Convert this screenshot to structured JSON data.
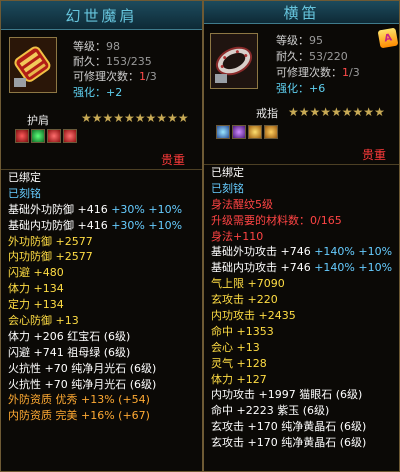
{
  "left": {
    "title": "幻世魔肩",
    "stats": {
      "level_label": "等级：",
      "level": "98",
      "durability_label": "耐久：",
      "durability": "153/235",
      "repair_label": "可修理次数：",
      "repair_used": "1",
      "repair_max": "/3",
      "enhance_label": "强化：",
      "enhance": "+2"
    },
    "slot_label": "护肩",
    "stars": "★★★★★★★★★★",
    "valuable": "贵重",
    "attrs": [
      {
        "parts": [
          {
            "t": "已绑定",
            "c": "w"
          }
        ]
      },
      {
        "parts": [
          {
            "t": "已刻铭",
            "c": "b"
          }
        ]
      },
      {
        "parts": [
          {
            "t": "基础外功防御 +416 ",
            "c": "w"
          },
          {
            "t": "+30% +10%",
            "c": "b"
          }
        ]
      },
      {
        "parts": [
          {
            "t": "基础内功防御 +416 ",
            "c": "w"
          },
          {
            "t": "+30% +10%",
            "c": "b"
          }
        ]
      },
      {
        "parts": [
          {
            "t": "外功防御 +2577",
            "c": "y"
          }
        ]
      },
      {
        "parts": [
          {
            "t": "内功防御 +2577",
            "c": "y"
          }
        ]
      },
      {
        "parts": [
          {
            "t": "闪避 +480",
            "c": "y"
          }
        ]
      },
      {
        "parts": [
          {
            "t": "体力 +134",
            "c": "y"
          }
        ]
      },
      {
        "parts": [
          {
            "t": "定力 +134",
            "c": "y"
          }
        ]
      },
      {
        "parts": [
          {
            "t": "会心防御 +13",
            "c": "y"
          }
        ]
      },
      {
        "parts": [
          {
            "t": "体力 +206 红宝石 (6级)",
            "c": "w"
          }
        ]
      },
      {
        "parts": [
          {
            "t": "闪避 +741 祖母绿 (6级)",
            "c": "w"
          }
        ]
      },
      {
        "parts": [
          {
            "t": "火抗性 +70 纯净月光石 (6级)",
            "c": "w"
          }
        ]
      },
      {
        "parts": [
          {
            "t": "火抗性 +70 纯净月光石 (6级)",
            "c": "w"
          }
        ]
      },
      {
        "parts": [
          {
            "t": "外防资质  优秀 +13% (+54)",
            "c": "o"
          }
        ]
      },
      {
        "parts": [
          {
            "t": "内防资质  完美 +16% (+67)",
            "c": "o"
          }
        ]
      }
    ]
  },
  "right": {
    "title": "横笛",
    "stats": {
      "level_label": "等级：",
      "level": "95",
      "durability_label": "耐久：",
      "durability": "53/220",
      "repair_label": "可修理次数：",
      "repair_used": "1",
      "repair_max": "/3",
      "enhance_label": "强化：",
      "enhance": "+6"
    },
    "slot_label": "戒指",
    "stars": "★★★★★★★★★",
    "valuable": "贵重",
    "badge": "A",
    "attrs": [
      {
        "parts": [
          {
            "t": "已绑定",
            "c": "w"
          }
        ]
      },
      {
        "parts": [
          {
            "t": "已刻铭",
            "c": "b"
          }
        ]
      },
      {
        "parts": [
          {
            "t": "身法醒纹5级",
            "c": "r"
          }
        ]
      },
      {
        "parts": [
          {
            "t": "升级需要的材料数：0/165",
            "c": "r"
          }
        ]
      },
      {
        "parts": [
          {
            "t": "身法+110",
            "c": "r"
          }
        ]
      },
      {
        "parts": [
          {
            "t": "基础外功攻击 +746 ",
            "c": "w"
          },
          {
            "t": "+140% +10%",
            "c": "b"
          }
        ]
      },
      {
        "parts": [
          {
            "t": "基础内功攻击 +746 ",
            "c": "w"
          },
          {
            "t": "+140% +10%",
            "c": "b"
          }
        ]
      },
      {
        "parts": [
          {
            "t": "气上限 +7090",
            "c": "y"
          }
        ]
      },
      {
        "parts": [
          {
            "t": "玄攻击 +220",
            "c": "y"
          }
        ]
      },
      {
        "parts": [
          {
            "t": "内功攻击 +2435",
            "c": "y"
          }
        ]
      },
      {
        "parts": [
          {
            "t": "命中 +1353",
            "c": "y"
          }
        ]
      },
      {
        "parts": [
          {
            "t": "会心 +13",
            "c": "y"
          }
        ]
      },
      {
        "parts": [
          {
            "t": "灵气 +128",
            "c": "y"
          }
        ]
      },
      {
        "parts": [
          {
            "t": "体力 +127",
            "c": "y"
          }
        ]
      },
      {
        "parts": [
          {
            "t": "内功攻击 +1997 猫眼石 (6级)",
            "c": "w"
          }
        ]
      },
      {
        "parts": [
          {
            "t": "命中 +2223 紫玉 (6级)",
            "c": "w"
          }
        ]
      },
      {
        "parts": [
          {
            "t": "玄攻击 +170 纯净黄晶石 (6级)",
            "c": "w"
          }
        ]
      },
      {
        "parts": [
          {
            "t": "玄攻击 +170 纯净黄晶石 (6级)",
            "c": "w"
          }
        ]
      }
    ]
  },
  "colors": {
    "title": "#66c4dc",
    "white": "#ffffff",
    "blue": "#66ccff",
    "yellow": "#ffdd44",
    "red": "#ff4444",
    "orange": "#ffaa33"
  }
}
